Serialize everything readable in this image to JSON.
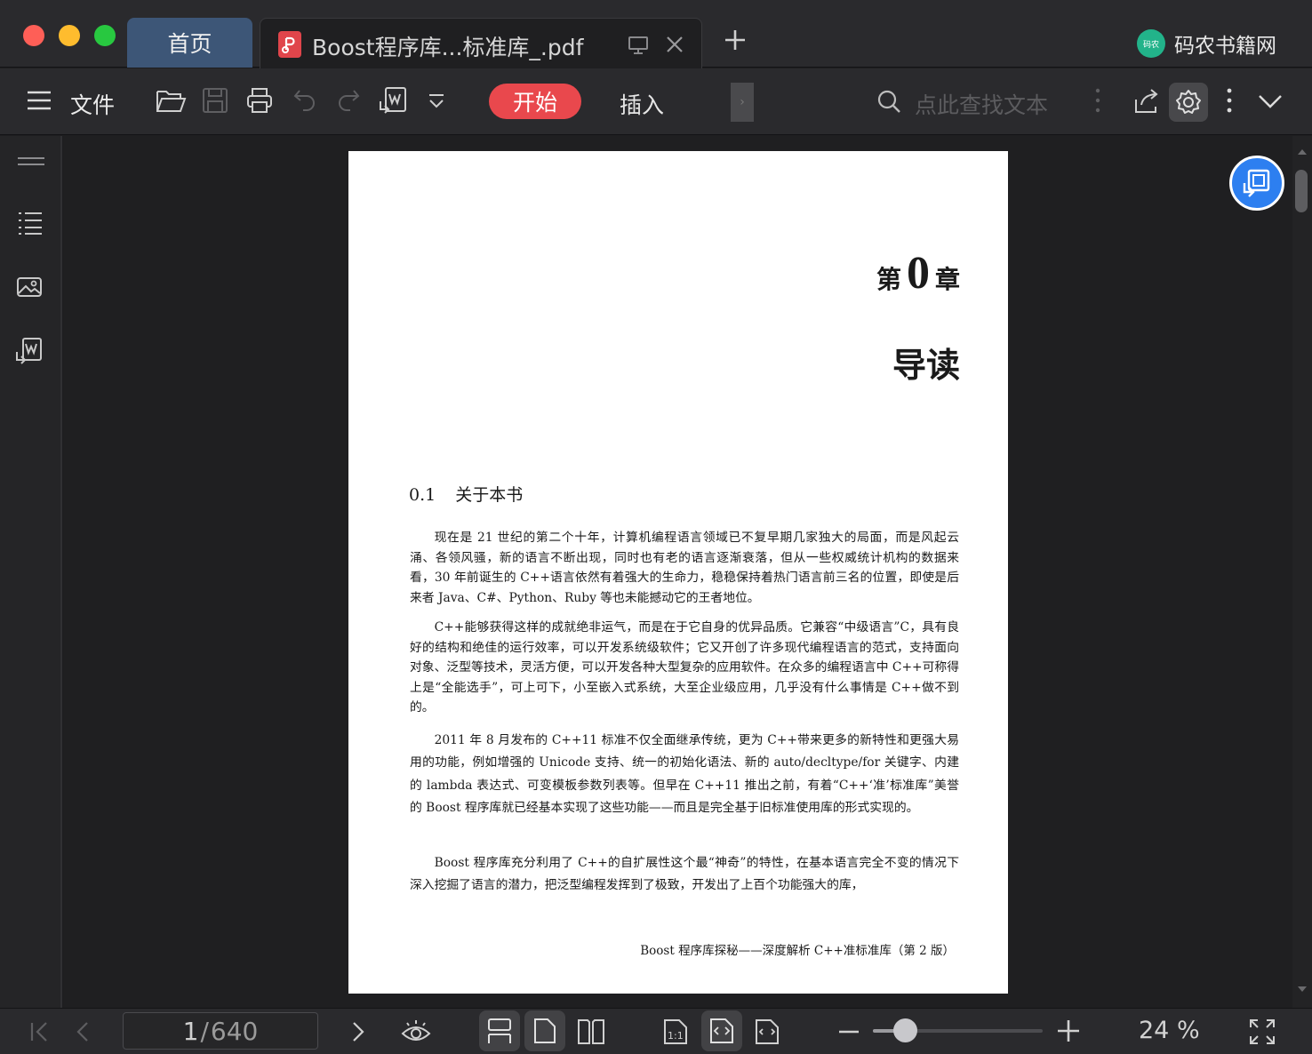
{
  "titlebar": {
    "home_tab": "首页",
    "doc_tab": "Boost程序库...标准库_.pdf",
    "brand_logo_text": "码农",
    "brand_name": "码农书籍网"
  },
  "toolbar": {
    "file_label": "文件",
    "start_label": "开始",
    "insert_label": "插入",
    "overflow_stub": "›",
    "search_placeholder": "点此查找文本"
  },
  "page": {
    "chapter_prefix": "第",
    "chapter_number": "0",
    "chapter_suffix": "章",
    "chapter_title": "导读",
    "section_number": "0.1",
    "section_title": "关于本书",
    "paragraphs": [
      "现在是 21 世纪的第二个十年，计算机编程语言领域已不复早期几家独大的局面，而是风起云涌、各领风骚，新的语言不断出现，同时也有老的语言逐渐衰落，但从一些权威统计机构的数据来看，30 年前诞生的 C++语言依然有着强大的生命力，稳稳保持着热门语言前三名的位置，即使是后来者 Java、C#、Python、Ruby 等也未能撼动它的王者地位。",
      "C++能够获得这样的成就绝非运气，而是在于它自身的优异品质。它兼容“中级语言”C，具有良好的结构和绝佳的运行效率，可以开发系统级软件；它又开创了许多现代编程语言的范式，支持面向对象、泛型等技术，灵活方便，可以开发各种大型复杂的应用软件。在众多的编程语言中 C++可称得上是“全能选手”，可上可下，小至嵌入式系统，大至企业级应用，几乎没有什么事情是 C++做不到的。",
      "2011 年 8 月发布的 C++11 标准不仅全面继承传统，更为 C++带来更多的新特性和更强大易用的功能，例如增强的 Unicode 支持、统一的初始化语法、新的 auto/decltype/for 关键字、内建的 lambda 表达式、可变模板参数列表等。但早在 C++11 推出之前，有着“C++‘准’标准库”美誉的 Boost 程序库就已经基本实现了这些功能——而且是完全基于旧标准使用库的形式实现的。",
      "Boost 程序库充分利用了 C++的自扩展性这个最“神奇”的特性，在基本语言完全不变的情况下深入挖掘了语言的潜力，把泛型编程发挥到了极致，开发出了上百个功能强大的库，"
    ],
    "footer": "Boost 程序库探秘——深度解析 C++准标准库（第 2 版）"
  },
  "statusbar": {
    "current_page": "1",
    "separator": "/",
    "total_pages": "640",
    "zoom_label": "24 %",
    "zoom_level_percent": 24
  },
  "colors": {
    "accent_red": "#e9484d",
    "active_tab": "#3d5677",
    "float_button": "#2d7ff0",
    "brand_green": "#22b38a"
  }
}
